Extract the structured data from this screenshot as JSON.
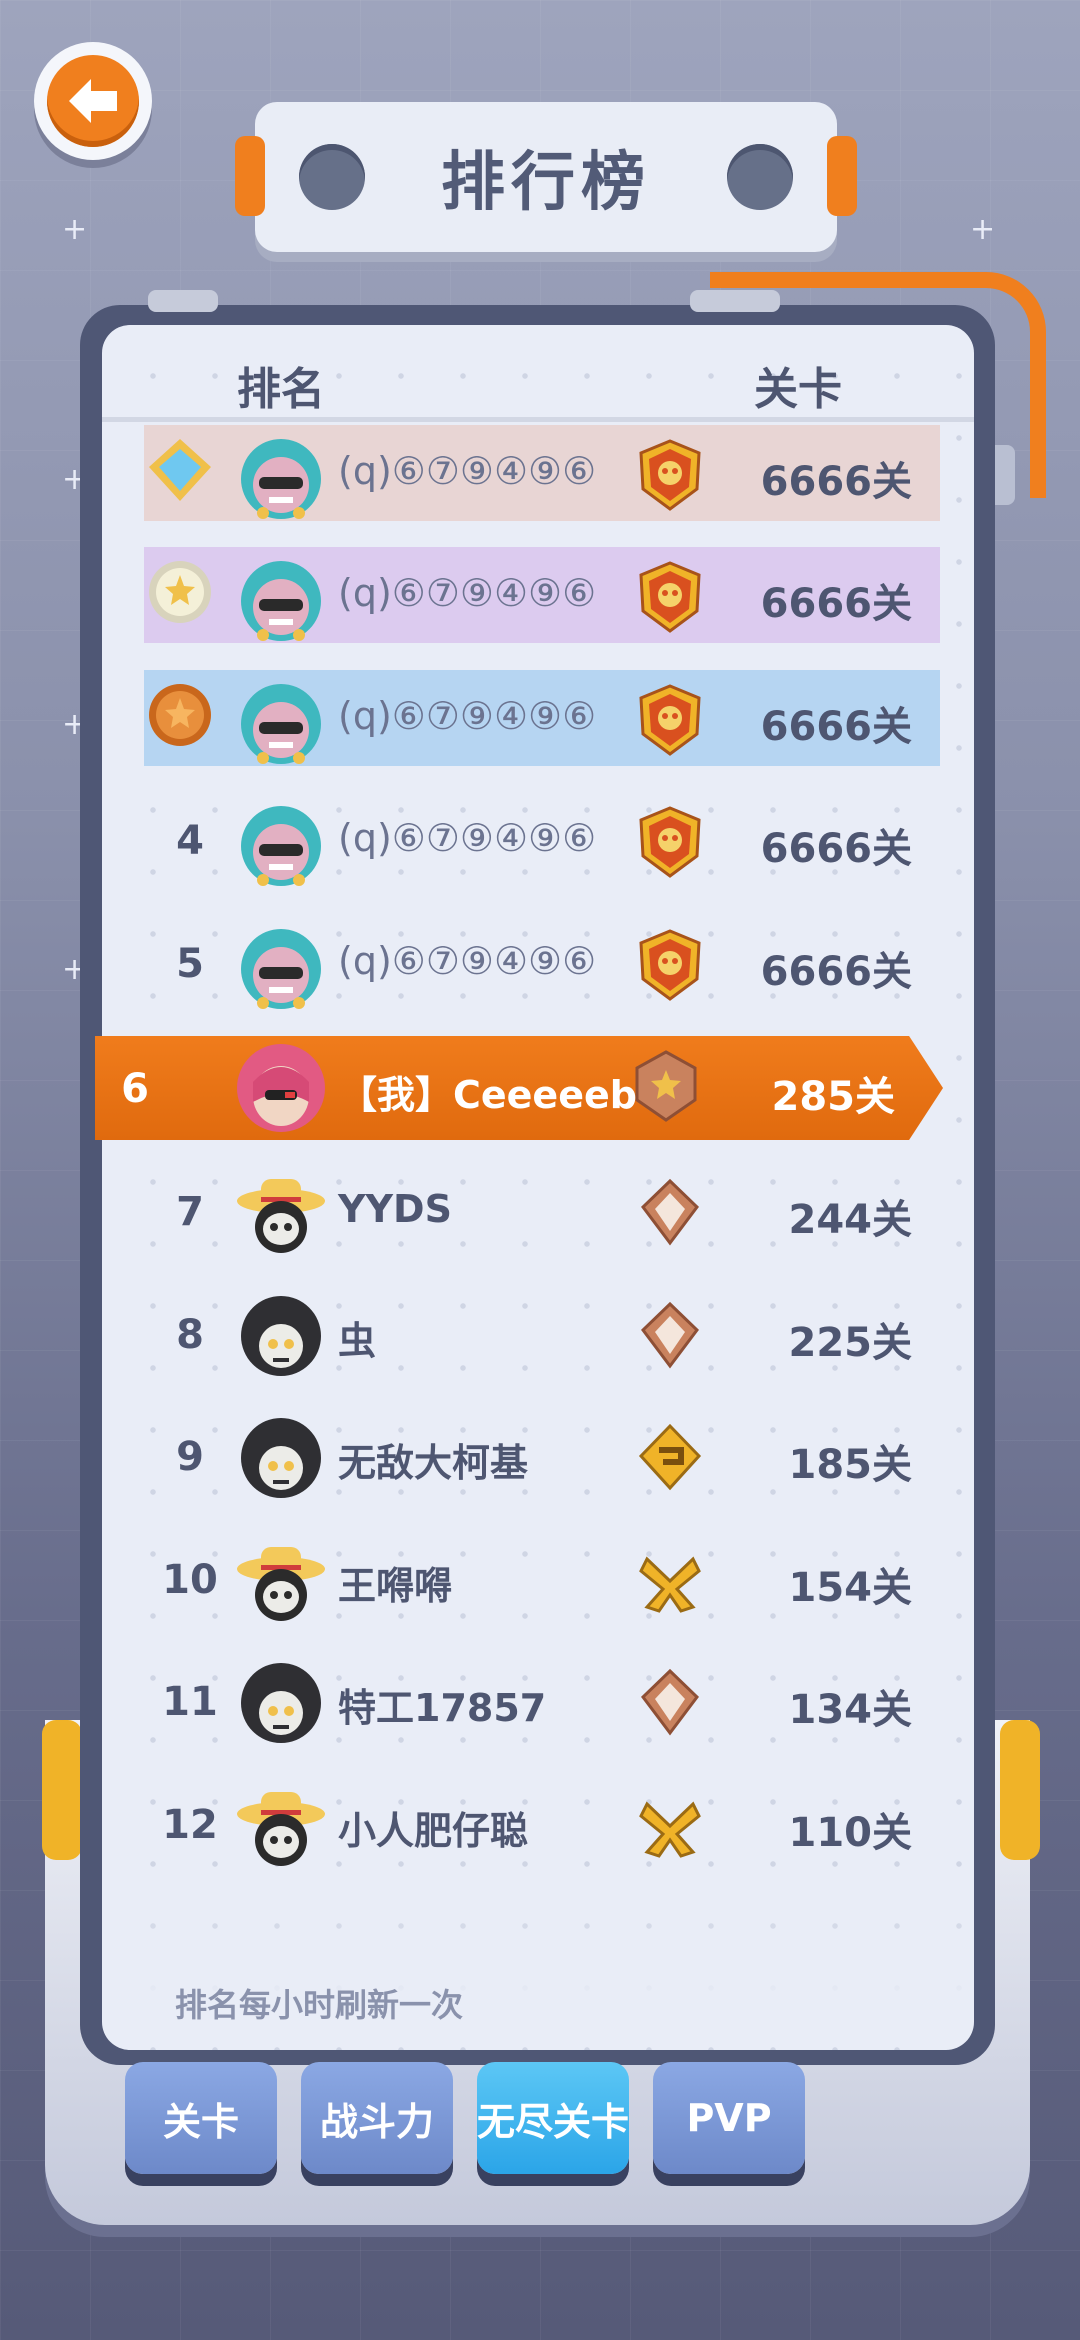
{
  "header": {
    "title": "排行榜"
  },
  "columns": {
    "rank": "排名",
    "level": "关卡"
  },
  "rows": [
    {
      "rank": "",
      "name": "(q)⑥⑦⑨④⑨⑥",
      "level": "6666关"
    },
    {
      "rank": "",
      "name": "(q)⑥⑦⑨④⑨⑥",
      "level": "6666关"
    },
    {
      "rank": "",
      "name": "(q)⑥⑦⑨④⑨⑥",
      "level": "6666关"
    },
    {
      "rank": "4",
      "name": "(q)⑥⑦⑨④⑨⑥",
      "level": "6666关"
    },
    {
      "rank": "5",
      "name": "(q)⑥⑦⑨④⑨⑥",
      "level": "6666关"
    },
    {
      "rank": "7",
      "name": "YYDS",
      "level": "244关"
    },
    {
      "rank": "8",
      "name": "虫",
      "level": "225关"
    },
    {
      "rank": "9",
      "name": "无敌大柯基",
      "level": "185关"
    },
    {
      "rank": "10",
      "name": "王嘚嘚",
      "level": "154关"
    },
    {
      "rank": "11",
      "name": "特工17857",
      "level": "134关"
    },
    {
      "rank": "12",
      "name": "小人肥仔聪",
      "level": "110关"
    }
  ],
  "me": {
    "rank": "6",
    "name": "【我】Ceeeeeb",
    "level": "285关"
  },
  "footer_note": "排名每小时刷新一次",
  "tabs": [
    {
      "label": "关卡",
      "active": false
    },
    {
      "label": "战斗力",
      "active": false
    },
    {
      "label": "无尽关卡",
      "active": true
    },
    {
      "label": "PVP",
      "active": false
    }
  ],
  "colors": {
    "accent": "#f07f1e",
    "active_tab": "#2ba5e8",
    "tab": "#7b97d6"
  },
  "icons": {
    "back": "arrow-left-icon",
    "medal": "shield-medal-icon",
    "avatar": "skull-avatar-icon"
  }
}
